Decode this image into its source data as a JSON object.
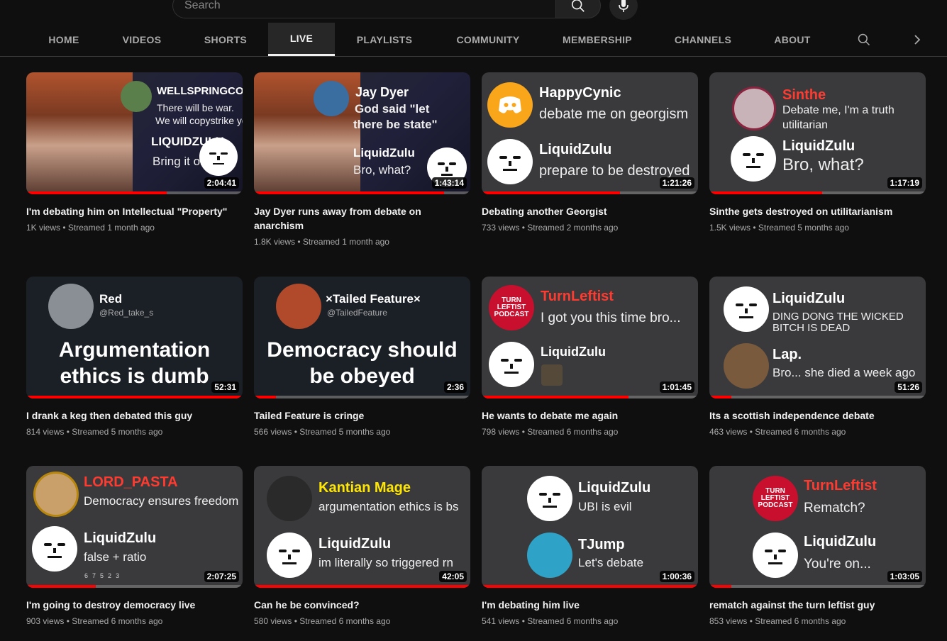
{
  "search": {
    "placeholder": "Search"
  },
  "tabs": [
    {
      "label": "HOME",
      "active": false
    },
    {
      "label": "VIDEOS",
      "active": false
    },
    {
      "label": "SHORTS",
      "active": false
    },
    {
      "label": "LIVE",
      "active": true
    },
    {
      "label": "PLAYLISTS",
      "active": false
    },
    {
      "label": "COMMUNITY",
      "active": false
    },
    {
      "label": "MEMBERSHIP",
      "active": false
    },
    {
      "label": "CHANNELS",
      "active": false
    },
    {
      "label": "ABOUT",
      "active": false
    }
  ],
  "colors": {
    "accent": "#ff0000",
    "background": "#0f0f0f",
    "name_red": "#ff3b30",
    "name_yellow": "#ffe600"
  },
  "videos": [
    {
      "title": "I'm debating him on Intellectual \"Property\"",
      "views": "1K views",
      "age": "Streamed 1 month ago",
      "duration": "2:04:41",
      "progress": 0.65,
      "thumb": {
        "n1": "WELLSPRINGCON",
        "t1": "There will be war.",
        "t1b": "We will copystrike you",
        "n2": "LIQUIDZULU",
        "t2": "Bring it on."
      }
    },
    {
      "title": "Jay Dyer runs away from debate on anarchism",
      "views": "1.8K views",
      "age": "Streamed 1 month ago",
      "duration": "1:43:14",
      "progress": 0.88,
      "thumb": {
        "n1": "Jay Dyer",
        "t1": "God said \"let",
        "t1b": "there be state\"",
        "n2": "LiquidZulu",
        "t2": "Bro, what?"
      }
    },
    {
      "title": "Debating another Georgist",
      "views": "733 views",
      "age": "Streamed 2 months ago",
      "duration": "1:21:26",
      "progress": 0.64,
      "thumb": {
        "n1": "HappyCynic",
        "t1": "debate me on georgism",
        "n2": "LiquidZulu",
        "t2": "prepare to be destroyed"
      }
    },
    {
      "title": "Sinthe gets destroyed on utilitarianism",
      "views": "1.5K views",
      "age": "Streamed 5 months ago",
      "duration": "1:17:19",
      "progress": 0.52,
      "thumb": {
        "n1": "Sinthe",
        "t1": "Debate me, I'm a truth",
        "t1b": "utilitarian",
        "n2": "LiquidZulu",
        "t2": "Bro, what?"
      }
    },
    {
      "title": "I drank a keg then debated this guy",
      "views": "814 views",
      "age": "Streamed 5 months ago",
      "duration": "52:31",
      "progress": 1.0,
      "thumb": {
        "n1": "Red",
        "h1": "@Red_take_s",
        "claim1": "Argumentation",
        "claim2": "ethics is dumb"
      }
    },
    {
      "title": "Tailed Feature is cringe",
      "views": "566 views",
      "age": "Streamed 5 months ago",
      "duration": "2:36",
      "progress": 0.1,
      "thumb": {
        "n1": "×Tailed Feature×",
        "h1": "@TailedFeature",
        "claim1": "Democracy should",
        "claim2": "be obeyed"
      }
    },
    {
      "title": "He wants to debate me again",
      "views": "798 views",
      "age": "Streamed 6 months ago",
      "duration": "1:01:45",
      "progress": 0.68,
      "thumb": {
        "n1": "TurnLeftist",
        "t1": "I got you this time bro...",
        "n2": "LiquidZulu",
        "logo": "TURN LEFTIST PODCAST"
      }
    },
    {
      "title": "Its a scottish independence debate",
      "views": "463 views",
      "age": "Streamed 6 months ago",
      "duration": "51:26",
      "progress": 0.1,
      "thumb": {
        "n1": "LiquidZulu",
        "t1": "DING DONG THE WICKED",
        "t1b": "BITCH IS DEAD",
        "n2": "Lap.",
        "t2": "Bro... she died a week ago"
      }
    },
    {
      "title": "I'm going to destroy democracy live",
      "views": "903 views",
      "age": "Streamed 6 months ago",
      "duration": "2:07:25",
      "progress": 0.32,
      "thumb": {
        "n1": "LORD_PASTA",
        "t1": "Democracy ensures freedom",
        "n2": "LiquidZulu",
        "t2": "false + ratio",
        "reactions": [
          "6",
          "7",
          "5",
          "2",
          "3"
        ]
      }
    },
    {
      "title": "Can he be convinced?",
      "views": "580 views",
      "age": "Streamed 6 months ago",
      "duration": "42:05",
      "progress": 1.0,
      "thumb": {
        "n1": "Kantian Mage",
        "t1": "argumentation ethics is bs",
        "n2": "LiquidZulu",
        "t2": "im literally so triggered rn"
      }
    },
    {
      "title": "I'm debating him live",
      "views": "541 views",
      "age": "Streamed 6 months ago",
      "duration": "1:00:36",
      "progress": 1.0,
      "thumb": {
        "n1": "LiquidZulu",
        "t1": "UBI is evil",
        "n2": "TJump",
        "t2": "Let's debate"
      }
    },
    {
      "title": "rematch against the turn leftist guy",
      "views": "853 views",
      "age": "Streamed 6 months ago",
      "duration": "1:03:05",
      "progress": 0.1,
      "thumb": {
        "n1": "TurnLeftist",
        "t1": "Rematch?",
        "n2": "LiquidZulu",
        "t2": "You're on...",
        "logo": "TURN LEFTIST PODCAST"
      }
    }
  ]
}
